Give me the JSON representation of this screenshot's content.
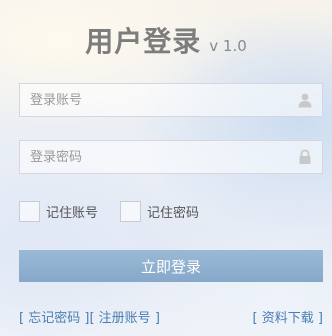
{
  "header": {
    "title": "用户登录",
    "version": "v 1.0"
  },
  "form": {
    "username_placeholder": "登录账号",
    "password_placeholder": "登录密码",
    "remember_account_label": "记住账号",
    "remember_password_label": "记住密码",
    "login_button": "立即登录"
  },
  "links": {
    "open_bracket": "[",
    "close_bracket": "]",
    "forgot_password": "忘记密码",
    "register": "注册账号",
    "downloads": "资料下载"
  },
  "icons": {
    "user": "user-icon",
    "lock": "lock-icon"
  },
  "colors": {
    "button": "#8fb0cf",
    "link": "#4a7db5",
    "title": "#7d7d7d"
  }
}
